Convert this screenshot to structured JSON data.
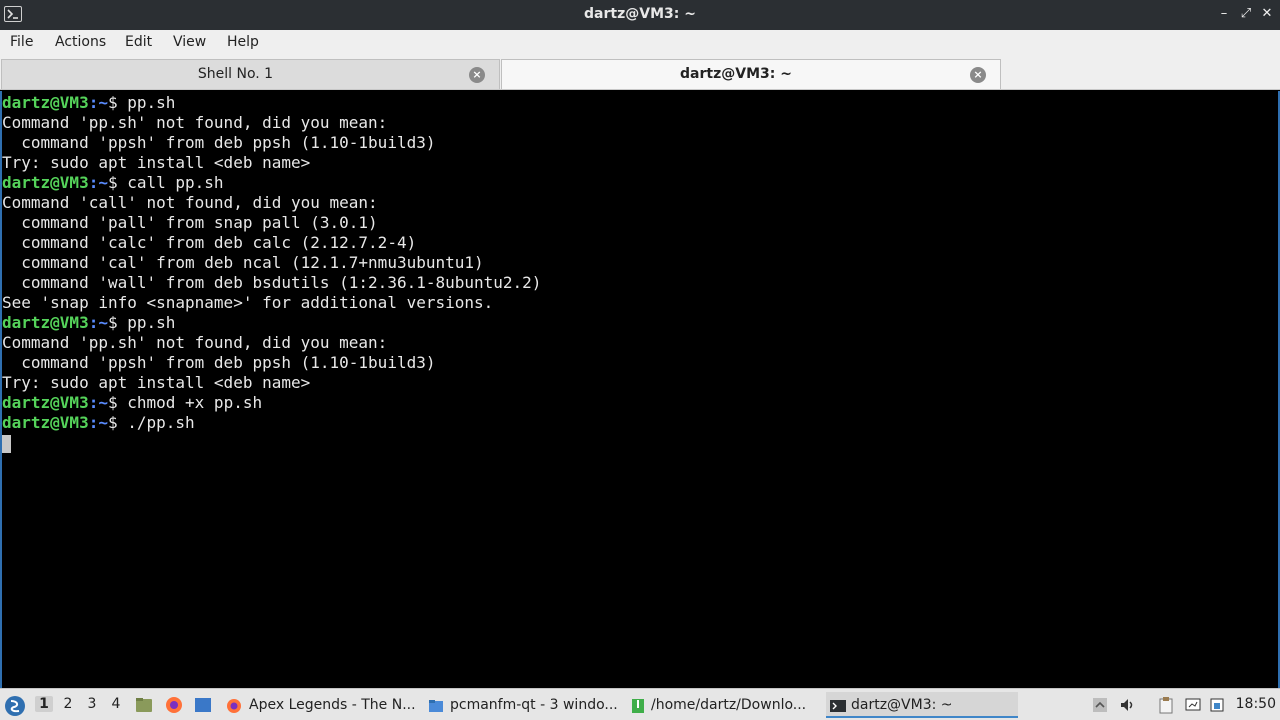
{
  "window": {
    "title": "dartz@VM3: ~",
    "icon": "terminal-icon",
    "controls": {
      "minimize": "–",
      "maximize": "⤢",
      "close": "✕"
    }
  },
  "menubar": {
    "items": [
      "File",
      "Actions",
      "Edit",
      "View",
      "Help"
    ]
  },
  "tabs": [
    {
      "label": "Shell No. 1",
      "active": false
    },
    {
      "label": "dartz@VM3: ~",
      "active": true
    }
  ],
  "terminal": {
    "prompt_user": "dartz@VM3",
    "prompt_path": ":~",
    "prompt_symbol": "$ ",
    "lines": [
      {
        "type": "prompt",
        "cmd": "pp.sh"
      },
      {
        "type": "out",
        "text": "Command 'pp.sh' not found, did you mean:"
      },
      {
        "type": "out",
        "text": "  command 'ppsh' from deb ppsh (1.10-1build3)"
      },
      {
        "type": "out",
        "text": "Try: sudo apt install <deb name>"
      },
      {
        "type": "prompt",
        "cmd": "call pp.sh"
      },
      {
        "type": "out",
        "text": "Command 'call' not found, did you mean:"
      },
      {
        "type": "out",
        "text": "  command 'pall' from snap pall (3.0.1)"
      },
      {
        "type": "out",
        "text": "  command 'calc' from deb calc (2.12.7.2-4)"
      },
      {
        "type": "out",
        "text": "  command 'cal' from deb ncal (12.1.7+nmu3ubuntu1)"
      },
      {
        "type": "out",
        "text": "  command 'wall' from deb bsdutils (1:2.36.1-8ubuntu2.2)"
      },
      {
        "type": "out",
        "text": "See 'snap info <snapname>' for additional versions."
      },
      {
        "type": "prompt",
        "cmd": "pp.sh"
      },
      {
        "type": "out",
        "text": "Command 'pp.sh' not found, did you mean:"
      },
      {
        "type": "out",
        "text": "  command 'ppsh' from deb ppsh (1.10-1build3)"
      },
      {
        "type": "out",
        "text": "Try: sudo apt install <deb name>"
      },
      {
        "type": "prompt",
        "cmd": "chmod +x pp.sh"
      },
      {
        "type": "prompt",
        "cmd": "./pp.sh"
      },
      {
        "type": "cursor"
      }
    ]
  },
  "taskbar": {
    "workspaces": [
      "1",
      "2",
      "3",
      "4"
    ],
    "active_workspace": "1",
    "tasks": [
      {
        "label": "Apex Legends - The N...",
        "icon": "firefox-icon",
        "active": false
      },
      {
        "label": "pcmanfm-qt - 3 windo...",
        "icon": "folder-icon",
        "active": false
      },
      {
        "label": "/home/dartz/Downlo...",
        "icon": "archive-icon",
        "active": false
      },
      {
        "label": "dartz@VM3: ~",
        "icon": "terminal-icon",
        "active": true
      }
    ],
    "clock": "18:50"
  },
  "colors": {
    "prompt_user": "#55d35a",
    "prompt_path": "#5a8cff",
    "terminal_bg": "#000000",
    "terminal_fg": "#e8e8e8",
    "accent": "#3f86c8"
  }
}
